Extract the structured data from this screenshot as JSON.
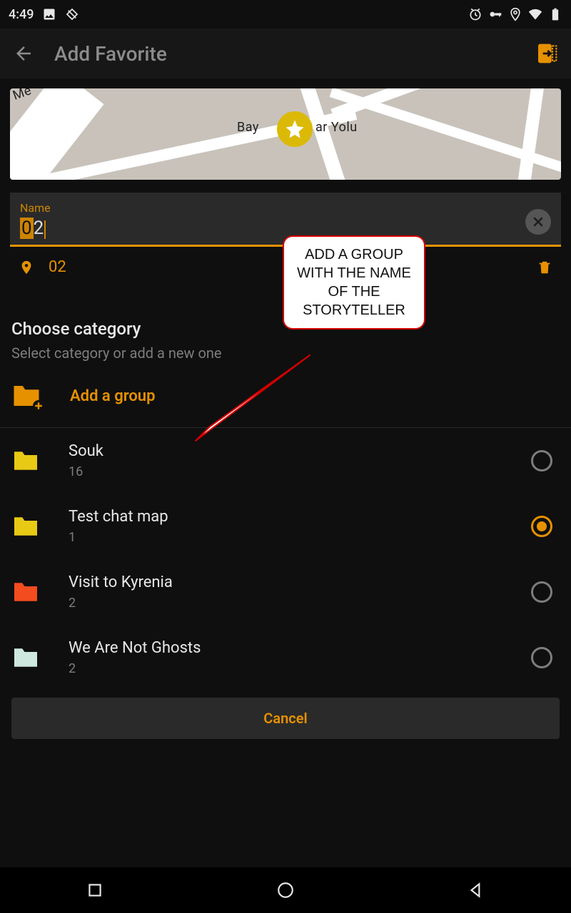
{
  "status": {
    "time": "4:49"
  },
  "appbar": {
    "title": "Add Favorite"
  },
  "map": {
    "road_label_left": "Bay",
    "road_label_right": "ar Yolu",
    "road_label_topleft": "Me"
  },
  "name_field": {
    "label": "Name",
    "value_sel": "0",
    "value_rest": "2"
  },
  "location": {
    "text": "02"
  },
  "section": {
    "title": "Choose category",
    "subtitle": "Select category or add a new one"
  },
  "add_group": {
    "label": "Add a group"
  },
  "categories": [
    {
      "name": "Souk",
      "count": "16",
      "color": "#e8c914",
      "selected": false
    },
    {
      "name": "Test chat map",
      "count": "1",
      "color": "#e8c914",
      "selected": true
    },
    {
      "name": "Visit to Kyrenia",
      "count": "2",
      "color": "#f24c1f",
      "selected": false
    },
    {
      "name": "We Are Not Ghosts",
      "count": "2",
      "color": "#cfe8df",
      "selected": false
    }
  ],
  "cancel": {
    "label": "Cancel"
  },
  "callout": {
    "text": "ADD A GROUP WITH  THE NAME OF THE STORYTELLER"
  }
}
